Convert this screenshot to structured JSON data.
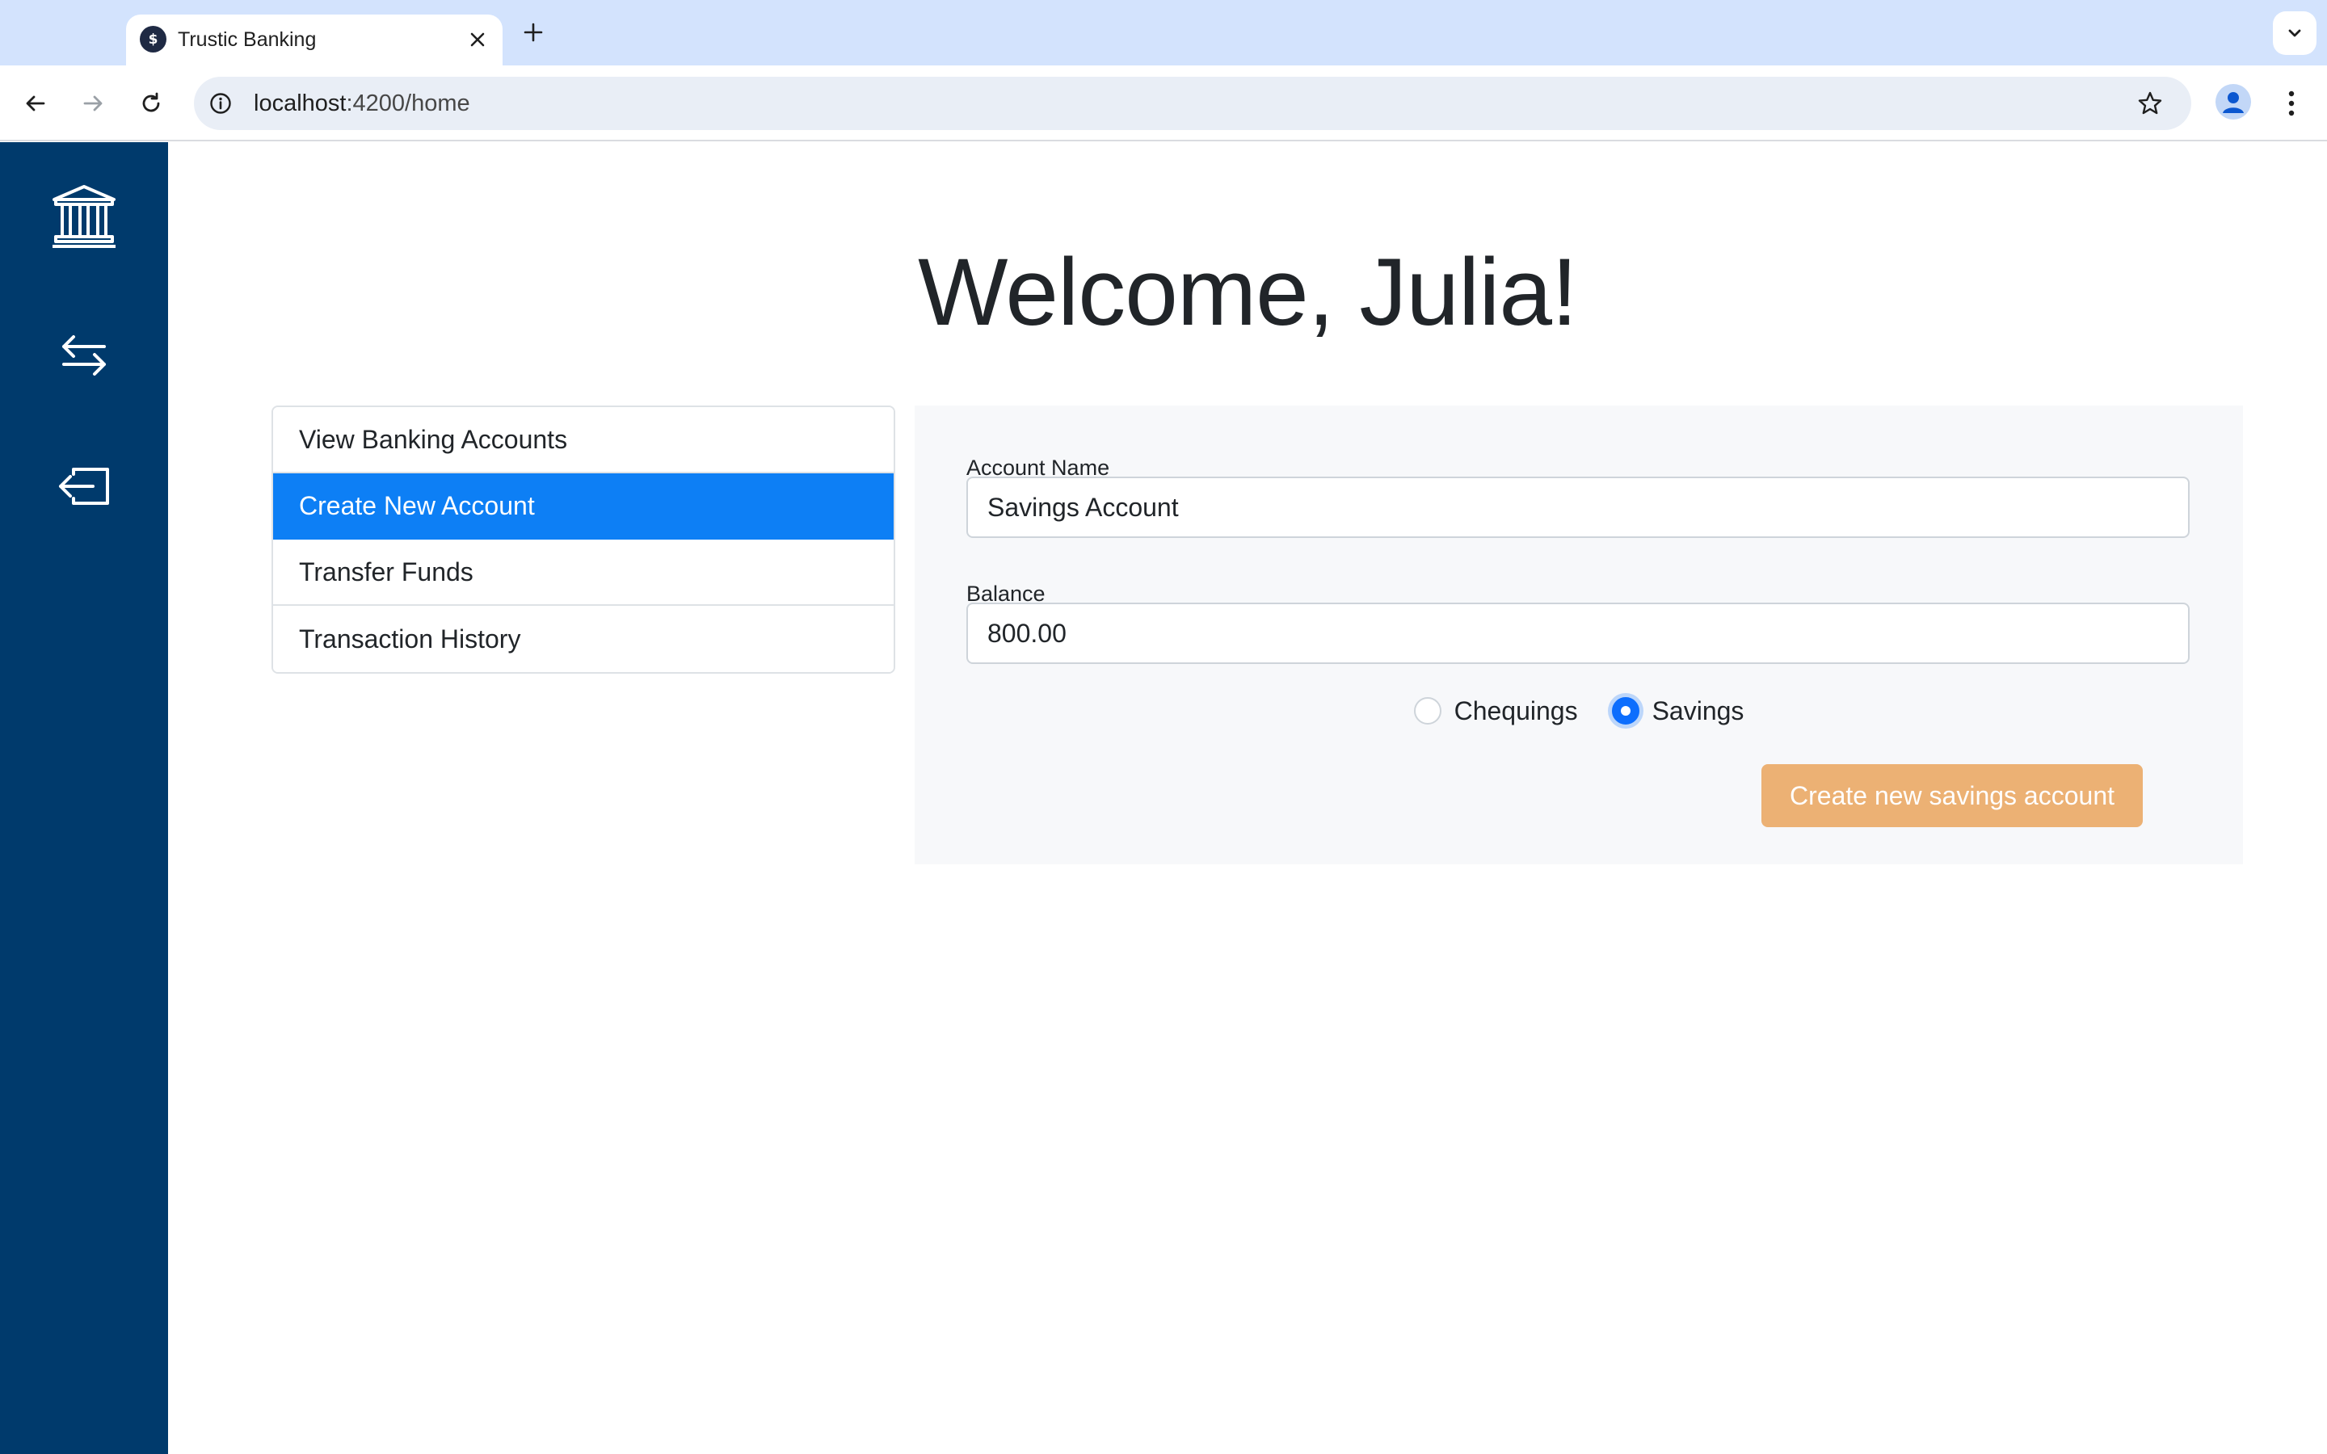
{
  "browser": {
    "tab_title": "Trustic Banking",
    "favicon_glyph": "$",
    "url_host": "localhost",
    "url_path": ":4200/home",
    "icons": [
      "close-icon",
      "plus-icon",
      "chevron-down-icon",
      "back-arrow-icon",
      "forward-arrow-icon",
      "reload-icon",
      "info-icon",
      "star-icon",
      "profile-icon",
      "kebab-menu-icon"
    ]
  },
  "sidebar": {
    "bg_color": "#003a6c",
    "icons": [
      "bank-icon",
      "transfer-arrows-icon",
      "logout-icon"
    ]
  },
  "main": {
    "welcome": "Welcome, Julia!"
  },
  "menu": {
    "items": [
      {
        "label": "View Banking Accounts",
        "active": false
      },
      {
        "label": "Create New Account",
        "active": true
      },
      {
        "label": "Transfer Funds",
        "active": false
      },
      {
        "label": "Transaction History",
        "active": false
      }
    ],
    "active_color": "#0d7ff5"
  },
  "form": {
    "account_name_label": "Account Name",
    "account_name_value": "Savings Account",
    "balance_label": "Balance",
    "balance_value": "800.00",
    "radio_options": [
      {
        "label": "Chequings",
        "checked": false
      },
      {
        "label": "Savings",
        "checked": true
      }
    ],
    "submit_label": "Create new savings account",
    "submit_color": "#ecb174"
  }
}
